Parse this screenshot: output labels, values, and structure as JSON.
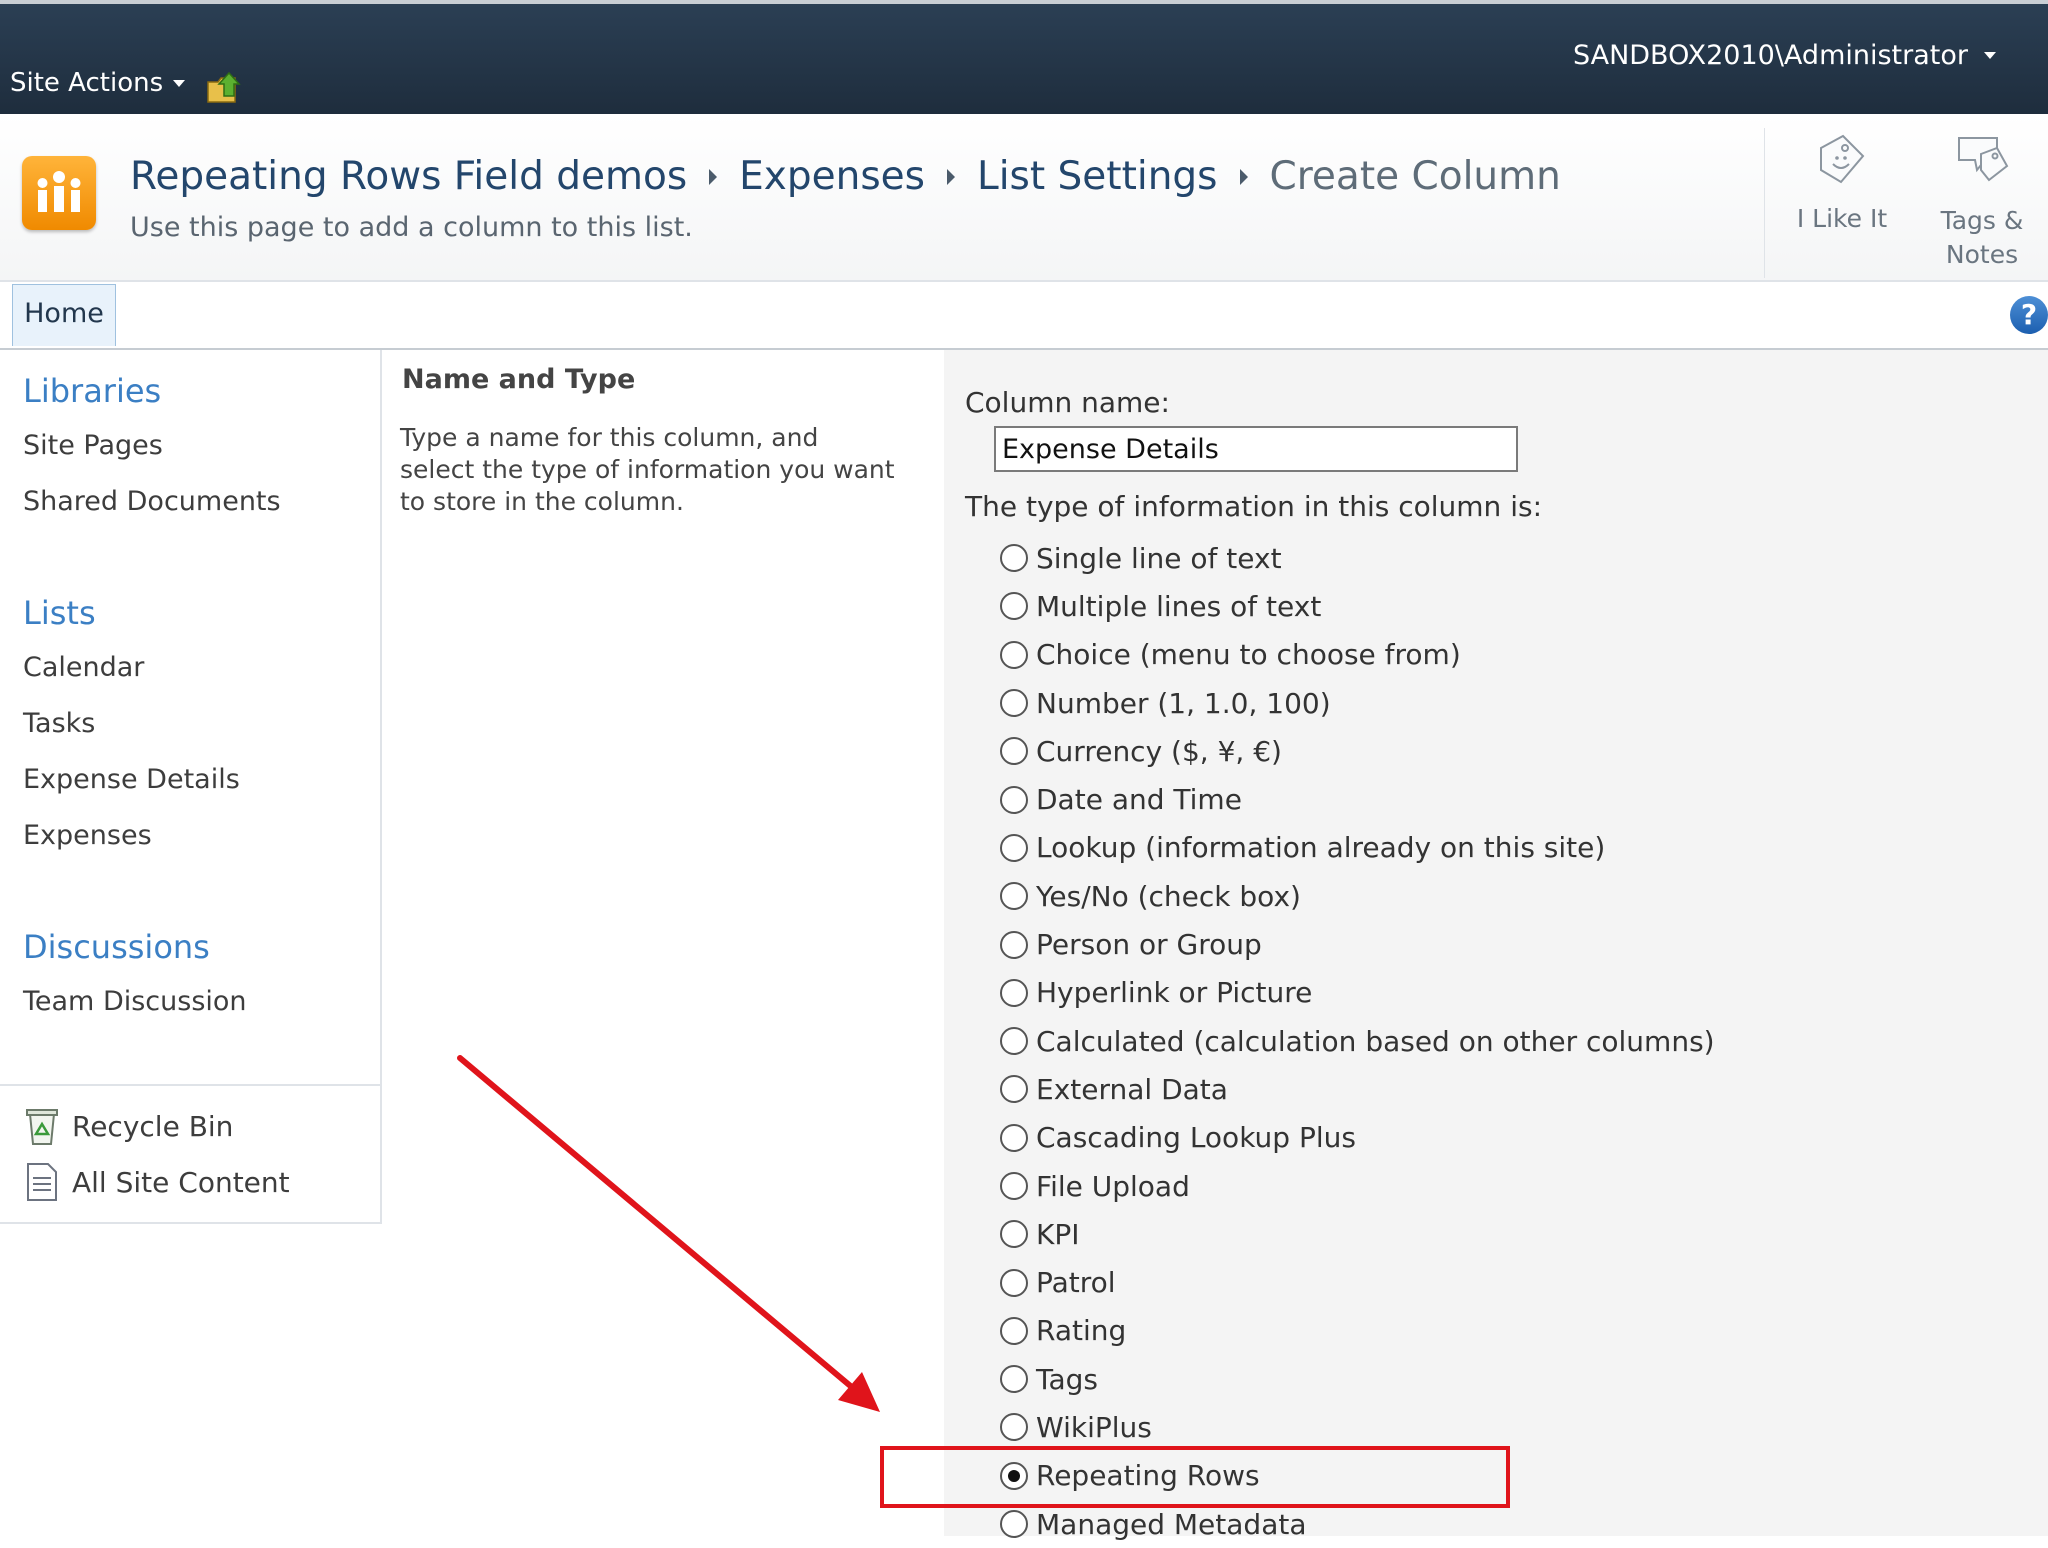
{
  "topbar": {
    "site_actions_label": "Site Actions",
    "user_label": "SANDBOX2010\\Administrator"
  },
  "breadcrumb": {
    "items": [
      "Repeating Rows Field demos",
      "Expenses",
      "List Settings"
    ],
    "current": "Create Column"
  },
  "page_description": "Use this page to add a column to this list.",
  "social": {
    "like_label": "I Like It",
    "tags_label_line1": "Tags &",
    "tags_label_line2": "Notes"
  },
  "ribbon": {
    "home_tab": "Home",
    "help_glyph": "?"
  },
  "leftnav": {
    "libraries": {
      "heading": "Libraries",
      "items": [
        "Site Pages",
        "Shared Documents"
      ]
    },
    "lists": {
      "heading": "Lists",
      "items": [
        "Calendar",
        "Tasks",
        "Expense Details",
        "Expenses"
      ]
    },
    "discussions": {
      "heading": "Discussions",
      "items": [
        "Team Discussion"
      ]
    },
    "recycle_bin": "Recycle Bin",
    "all_site_content": "All Site Content"
  },
  "section": {
    "title": "Name and Type",
    "description": "Type a name for this column, and select the type of information you want to store in the column."
  },
  "form": {
    "column_name_label": "Column name:",
    "column_name_value": "Expense Details",
    "type_label": "The type of information in this column is:",
    "selected_type": "Repeating Rows",
    "types": [
      "Single line of text",
      "Multiple lines of text",
      "Choice (menu to choose from)",
      "Number (1, 1.0, 100)",
      "Currency ($, ¥, €)",
      "Date and Time",
      "Lookup (information already on this site)",
      "Yes/No (check box)",
      "Person or Group",
      "Hyperlink or Picture",
      "Calculated (calculation based on other columns)",
      "External Data",
      "Cascading Lookup Plus",
      "File Upload",
      "KPI",
      "Patrol",
      "Rating",
      "Tags",
      "WikiPlus",
      "Repeating Rows",
      "Managed Metadata"
    ]
  },
  "colors": {
    "topbar": "#1e2d3d",
    "link_blue": "#3b7fc4",
    "annotation_red": "#e0141b",
    "logo_orange": "#f59a12"
  }
}
